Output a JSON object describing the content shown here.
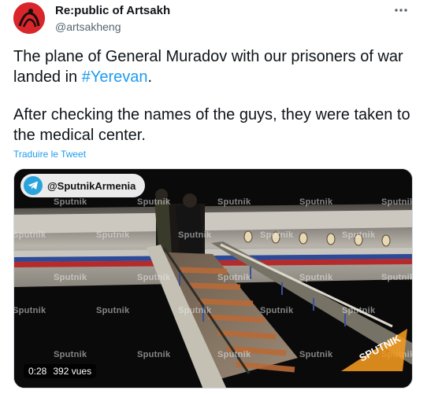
{
  "author": {
    "name": "Re:public of Artsakh",
    "handle": "@artsakheng"
  },
  "tweet": {
    "line1_text": "The plane of General Muradov with our prisoners of war landed in ",
    "hashtag": "#Yerevan",
    "line1_end": ".",
    "line2_text": "After checking the names of the guys, they were taken to the medical center."
  },
  "translate_label": "Traduire le Tweet",
  "media": {
    "source_label": "@SputnikArmenia",
    "watermark": "Sputnik",
    "brand_badge": "SPUTNIK",
    "duration": "0:28",
    "views": "392 vues"
  },
  "colors": {
    "link": "#1d9bf0",
    "avatar_bg": "#d9262b",
    "telegram": "#2aa3dd",
    "brand_orange": "#f29a1f"
  }
}
